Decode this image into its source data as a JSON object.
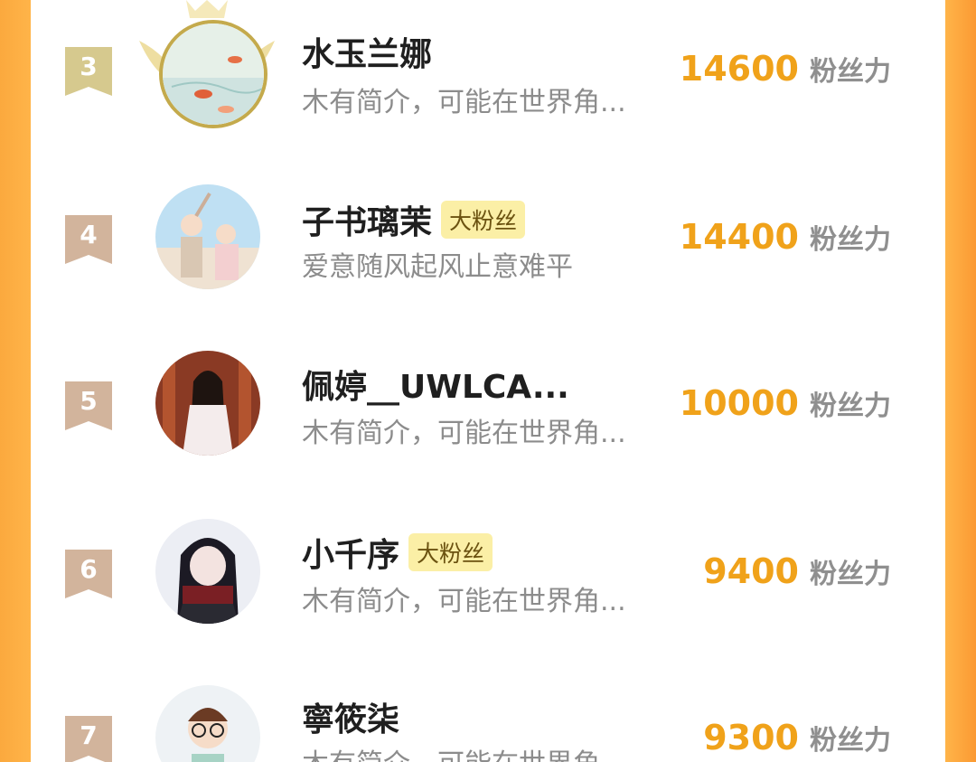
{
  "ranking": {
    "rows": [
      {
        "rank": "3",
        "name": "水玉兰娜",
        "badge": "",
        "bio": "木有简介，可能在世界角...",
        "score": "14600",
        "unit": "粉丝力",
        "avatar_icon": "koi-fish-painting-avatar-with-laurel-frame"
      },
      {
        "rank": "4",
        "name": "子书璃茉",
        "badge": "大粉丝",
        "bio": "爱意随风起风止意难平",
        "score": "14400",
        "unit": "粉丝力",
        "avatar_icon": "couple-illustration-avatar"
      },
      {
        "rank": "5",
        "name": "佩婷__UWLCA...",
        "badge": "",
        "bio": "木有简介，可能在世界角...",
        "score": "10000",
        "unit": "粉丝力",
        "avatar_icon": "woman-photo-avatar"
      },
      {
        "rank": "6",
        "name": "小千序",
        "badge": "大粉丝",
        "bio": "木有简介，可能在世界角...",
        "score": "9400",
        "unit": "粉丝力",
        "avatar_icon": "anime-girl-avatar"
      },
      {
        "rank": "7",
        "name": "寧筱柒",
        "badge": "",
        "bio": "木有简介，可能在世界角...",
        "score": "9300",
        "unit": "粉丝力",
        "avatar_icon": "child-with-glasses-avatar"
      }
    ]
  },
  "colors": {
    "accent_orange": "#f0a21a",
    "frame_orange": "#ffb449",
    "rank3_badge": "#d6c98e",
    "rank_badge": "#d2b49c",
    "fan_badge_bg": "#fbefa6"
  }
}
